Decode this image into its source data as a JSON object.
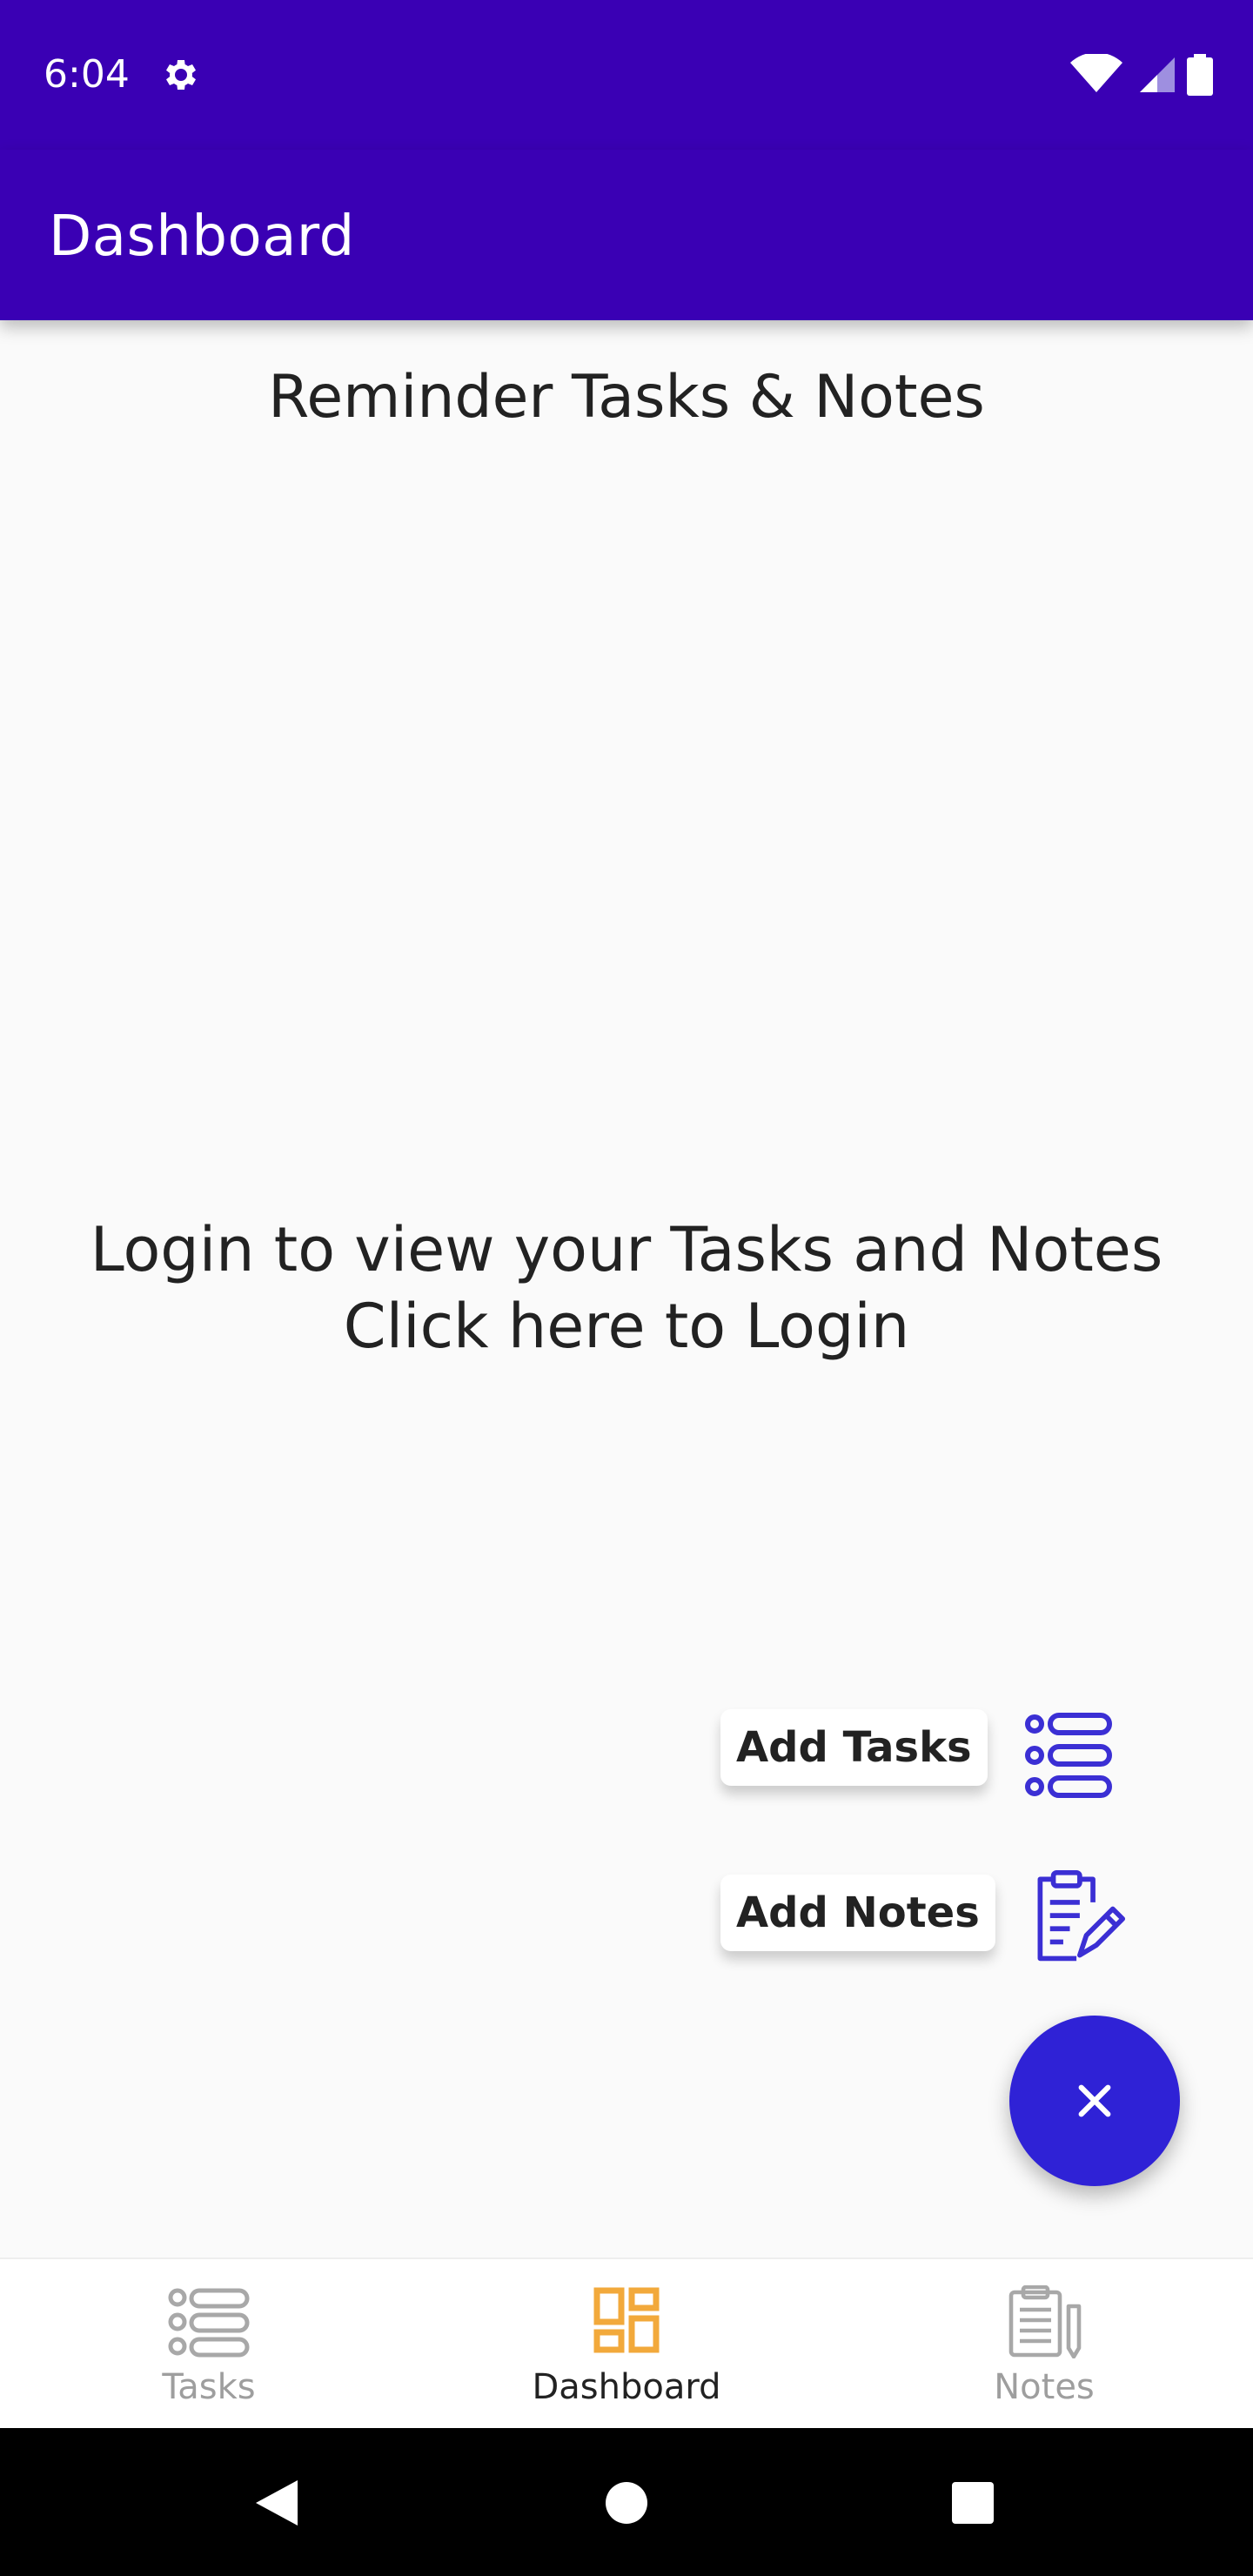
{
  "status_bar": {
    "time": "6:04"
  },
  "app_bar": {
    "title": "Dashboard"
  },
  "main": {
    "heading": "Reminder Tasks & Notes",
    "login_line1": "Login to view your Tasks and Notes",
    "login_line2": "Click here to Login"
  },
  "fab_menu": {
    "add_tasks_label": "Add Tasks",
    "add_notes_label": "Add Notes",
    "close_symbol": "×"
  },
  "bottom_nav": {
    "items": [
      {
        "label": "Tasks",
        "icon": "tasks-list-icon",
        "active": false
      },
      {
        "label": "Dashboard",
        "icon": "dashboard-icon",
        "active": true
      },
      {
        "label": "Notes",
        "icon": "notes-clipboard-icon",
        "active": false
      }
    ]
  },
  "colors": {
    "primary": "#3a00b4",
    "fab": "#2f22d6",
    "active_nav_icon": "#f2a93b",
    "inactive_nav": "#9e9e9e"
  }
}
